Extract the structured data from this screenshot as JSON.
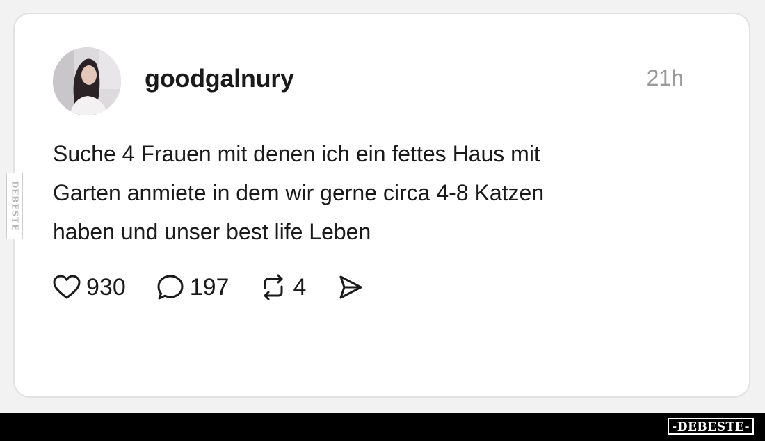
{
  "post": {
    "username": "goodgalnury",
    "timestamp": "21h",
    "text": "Suche 4 Frauen mit denen ich ein fettes Haus mit\nGarten anmiete in dem wir gerne circa 4-8 Katzen\nhaben und unser best life Leben",
    "actions": {
      "likes": "930",
      "comments": "197",
      "reposts": "4"
    },
    "icons": {
      "like": "heart-icon",
      "comment": "speech-bubble-icon",
      "repost": "repost-icon",
      "share": "send-icon"
    }
  },
  "watermark": {
    "side": "DEBESTE",
    "bottom": "-DEBESTE-"
  },
  "colors": {
    "background": "#f2f2f2",
    "card": "#ffffff",
    "text": "#1a1a1a",
    "muted": "#9a9a9a",
    "bar": "#000000"
  }
}
